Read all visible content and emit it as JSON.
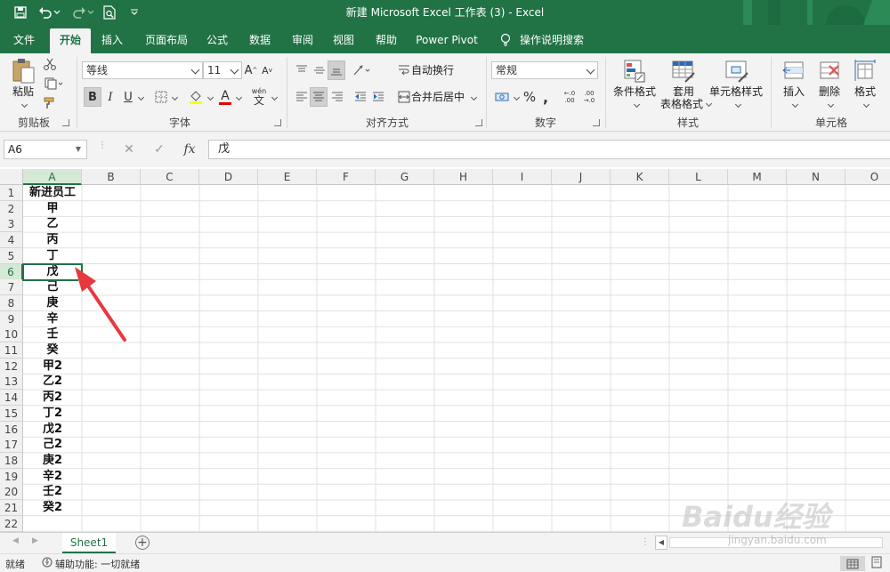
{
  "window": {
    "title": "新建 Microsoft Excel 工作表 (3)  -  Excel"
  },
  "menu_tabs": [
    {
      "label": "文件"
    },
    {
      "label": "开始"
    },
    {
      "label": "插入"
    },
    {
      "label": "页面布局"
    },
    {
      "label": "公式"
    },
    {
      "label": "数据"
    },
    {
      "label": "审阅"
    },
    {
      "label": "视图"
    },
    {
      "label": "帮助"
    },
    {
      "label": "Power Pivot"
    },
    {
      "label": "操作说明搜索"
    }
  ],
  "ribbon": {
    "clipboard": {
      "paste": "粘贴",
      "group": "剪贴板"
    },
    "font": {
      "name": "等线",
      "size": "11",
      "group": "字体",
      "grow": "A",
      "shrink": "A",
      "bold": "B",
      "italic": "I",
      "underline": "U",
      "color_letter": "A",
      "wen": "wén",
      "wen_char": "文"
    },
    "alignment": {
      "wrap": "自动换行",
      "merge": "合并后居中",
      "group": "对齐方式"
    },
    "number": {
      "format": "常规",
      "group": "数字",
      "percent": "%",
      "comma": ",",
      "inc_decimal": "←.0 .00",
      "dec_decimal": ".00 →.0"
    },
    "styles": {
      "conditional": "条件格式",
      "table_1": "套用",
      "table_2": "表格格式",
      "cell_styles": "单元格样式",
      "group": "样式"
    },
    "cells": {
      "insert": "插入",
      "delete": "删除",
      "format": "格式",
      "group": "单元格"
    },
    "accent": "#217346"
  },
  "formula_bar": {
    "name_box": "A6",
    "cancel": "✕",
    "enter": "✓",
    "fx": "fx",
    "content": "戊"
  },
  "sheet": {
    "columns": [
      "A",
      "B",
      "C",
      "D",
      "E",
      "F",
      "G",
      "H",
      "I",
      "J",
      "K",
      "L",
      "M",
      "N",
      "O"
    ],
    "rows": [
      "1",
      "2",
      "3",
      "4",
      "5",
      "6",
      "7",
      "8",
      "9",
      "10",
      "11",
      "12",
      "13",
      "14",
      "15",
      "16",
      "17",
      "18",
      "19",
      "20",
      "21",
      "22"
    ],
    "column_a": [
      "新进员工",
      "甲",
      "乙",
      "丙",
      "丁",
      "戊",
      "己",
      "庚",
      "辛",
      "壬",
      "癸",
      "甲2",
      "乙2",
      "丙2",
      "丁2",
      "戊2",
      "己2",
      "庚2",
      "辛2",
      "壬2",
      "癸2",
      ""
    ],
    "selected_row": 6,
    "selected_col": "A"
  },
  "sheet_tabs": {
    "active": "Sheet1",
    "add": "+"
  },
  "status": {
    "ready": "就绪",
    "accessibility": "辅助功能: 一切就绪"
  },
  "watermark": {
    "text": "Baidu经验",
    "url": "jingyan.baidu.com"
  }
}
